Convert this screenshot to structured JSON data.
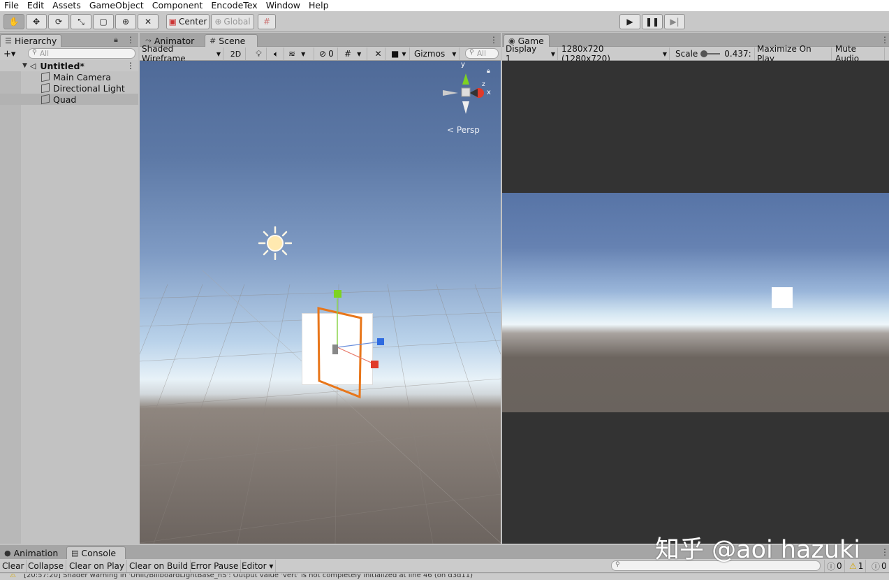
{
  "menu": [
    "File",
    "Edit",
    "Assets",
    "GameObject",
    "Component",
    "EncodeTex",
    "Window",
    "Help"
  ],
  "toolbar": {
    "pivot_label": "Center",
    "space_label": "Global",
    "tools": [
      "hand-tool-icon",
      "move-tool-icon",
      "rotate-tool-icon",
      "scale-tool-icon",
      "rect-tool-icon",
      "transform-tool-icon",
      "custom-tool-icon"
    ]
  },
  "hierarchy": {
    "tab_label": "Hierarchy",
    "add_label": "+▾",
    "search_placeholder": "All",
    "scene_name": "Untitled*",
    "items": [
      {
        "label": "Main Camera"
      },
      {
        "label": "Directional Light"
      },
      {
        "label": "Quad"
      }
    ]
  },
  "scene": {
    "tabs": [
      {
        "label": "Animator"
      },
      {
        "label": "Scene"
      }
    ],
    "draw_mode": "Shaded Wireframe",
    "mode_2d": "2D",
    "hidden_count": "0",
    "gizmos_label": "Gizmos",
    "search_placeholder": "All",
    "persp_label": "Persp",
    "axis_y": "y",
    "axis_x": "x",
    "axis_z": "z"
  },
  "game": {
    "tab_label": "Game",
    "display": "Display 1",
    "resolution": "1280x720 (1280x720)",
    "scale_label": "Scale",
    "scale_value": "0.437:",
    "maximize_label": "Maximize On Play",
    "mute_label": "Mute Audio"
  },
  "console": {
    "tabs": [
      {
        "label": "Animation"
      },
      {
        "label": "Console"
      }
    ],
    "buttons": [
      "Clear",
      "Collapse",
      "Clear on Play",
      "Clear on Build",
      "Error Pause",
      "Editor ▾"
    ],
    "info_count": "0",
    "warning_count": "1",
    "error_count": "0",
    "log_line": "[20:57:20] Shader warning in 'Unlit/BillboardLightBase_hS': Output value 'vert' is not completely initialized at line 46 (on d3d11)"
  },
  "watermark": "知乎 @aoi hazuki",
  "colors": {
    "selection_orange": "#e8761a",
    "gizmo_y": "#7ed321",
    "gizmo_x": "#e03a2a",
    "gizmo_z": "#2e6be0"
  }
}
